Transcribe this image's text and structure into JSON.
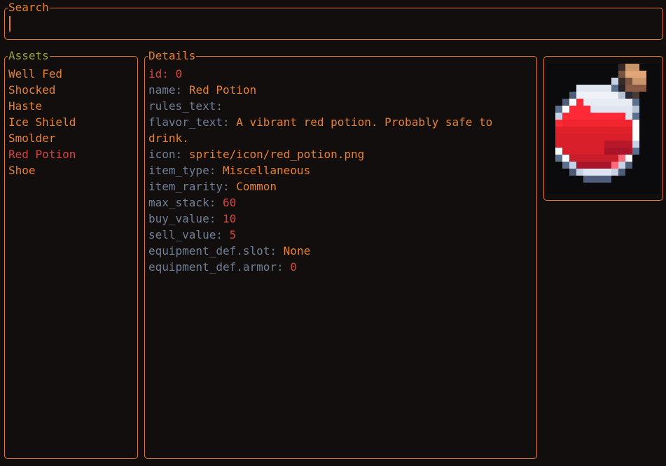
{
  "search": {
    "title": "Search",
    "value": ""
  },
  "assets": {
    "title": "Assets",
    "items": [
      "Well Fed",
      "Shocked",
      "Haste",
      "Ice Shield",
      "Smolder",
      "Red Potion",
      "Shoe"
    ],
    "selected_index": 5
  },
  "details": {
    "title": "Details",
    "rows": [
      {
        "key": "id:",
        "value": "0"
      },
      {
        "key": "name:",
        "value": "Red Potion"
      },
      {
        "key": "rules_text:",
        "value": ""
      },
      {
        "key": "flavor_text:",
        "value": "A vibrant red potion. Probably safe to drink."
      },
      {
        "key": "icon:",
        "value": "sprite/icon/red_potion.png"
      },
      {
        "key": "item_type:",
        "value": "Miscellaneous"
      },
      {
        "key": "item_rarity:",
        "value": "Common"
      },
      {
        "key": "max_stack:",
        "value": "60"
      },
      {
        "key": "buy_value:",
        "value": "10"
      },
      {
        "key": "sell_value:",
        "value": "5"
      },
      {
        "key": "equipment_def.slot:",
        "value": "None"
      },
      {
        "key": "equipment_def.armor:",
        "value": "0"
      }
    ]
  },
  "preview": {
    "icon": "red-potion-sprite"
  },
  "colors": {
    "border": "#e07b2a",
    "text": "#e8822e",
    "selected": "#d9443b",
    "key": "#6f8197",
    "number": "#d9443b",
    "assets_title": "#9aa23a",
    "background": "#120e0d"
  }
}
